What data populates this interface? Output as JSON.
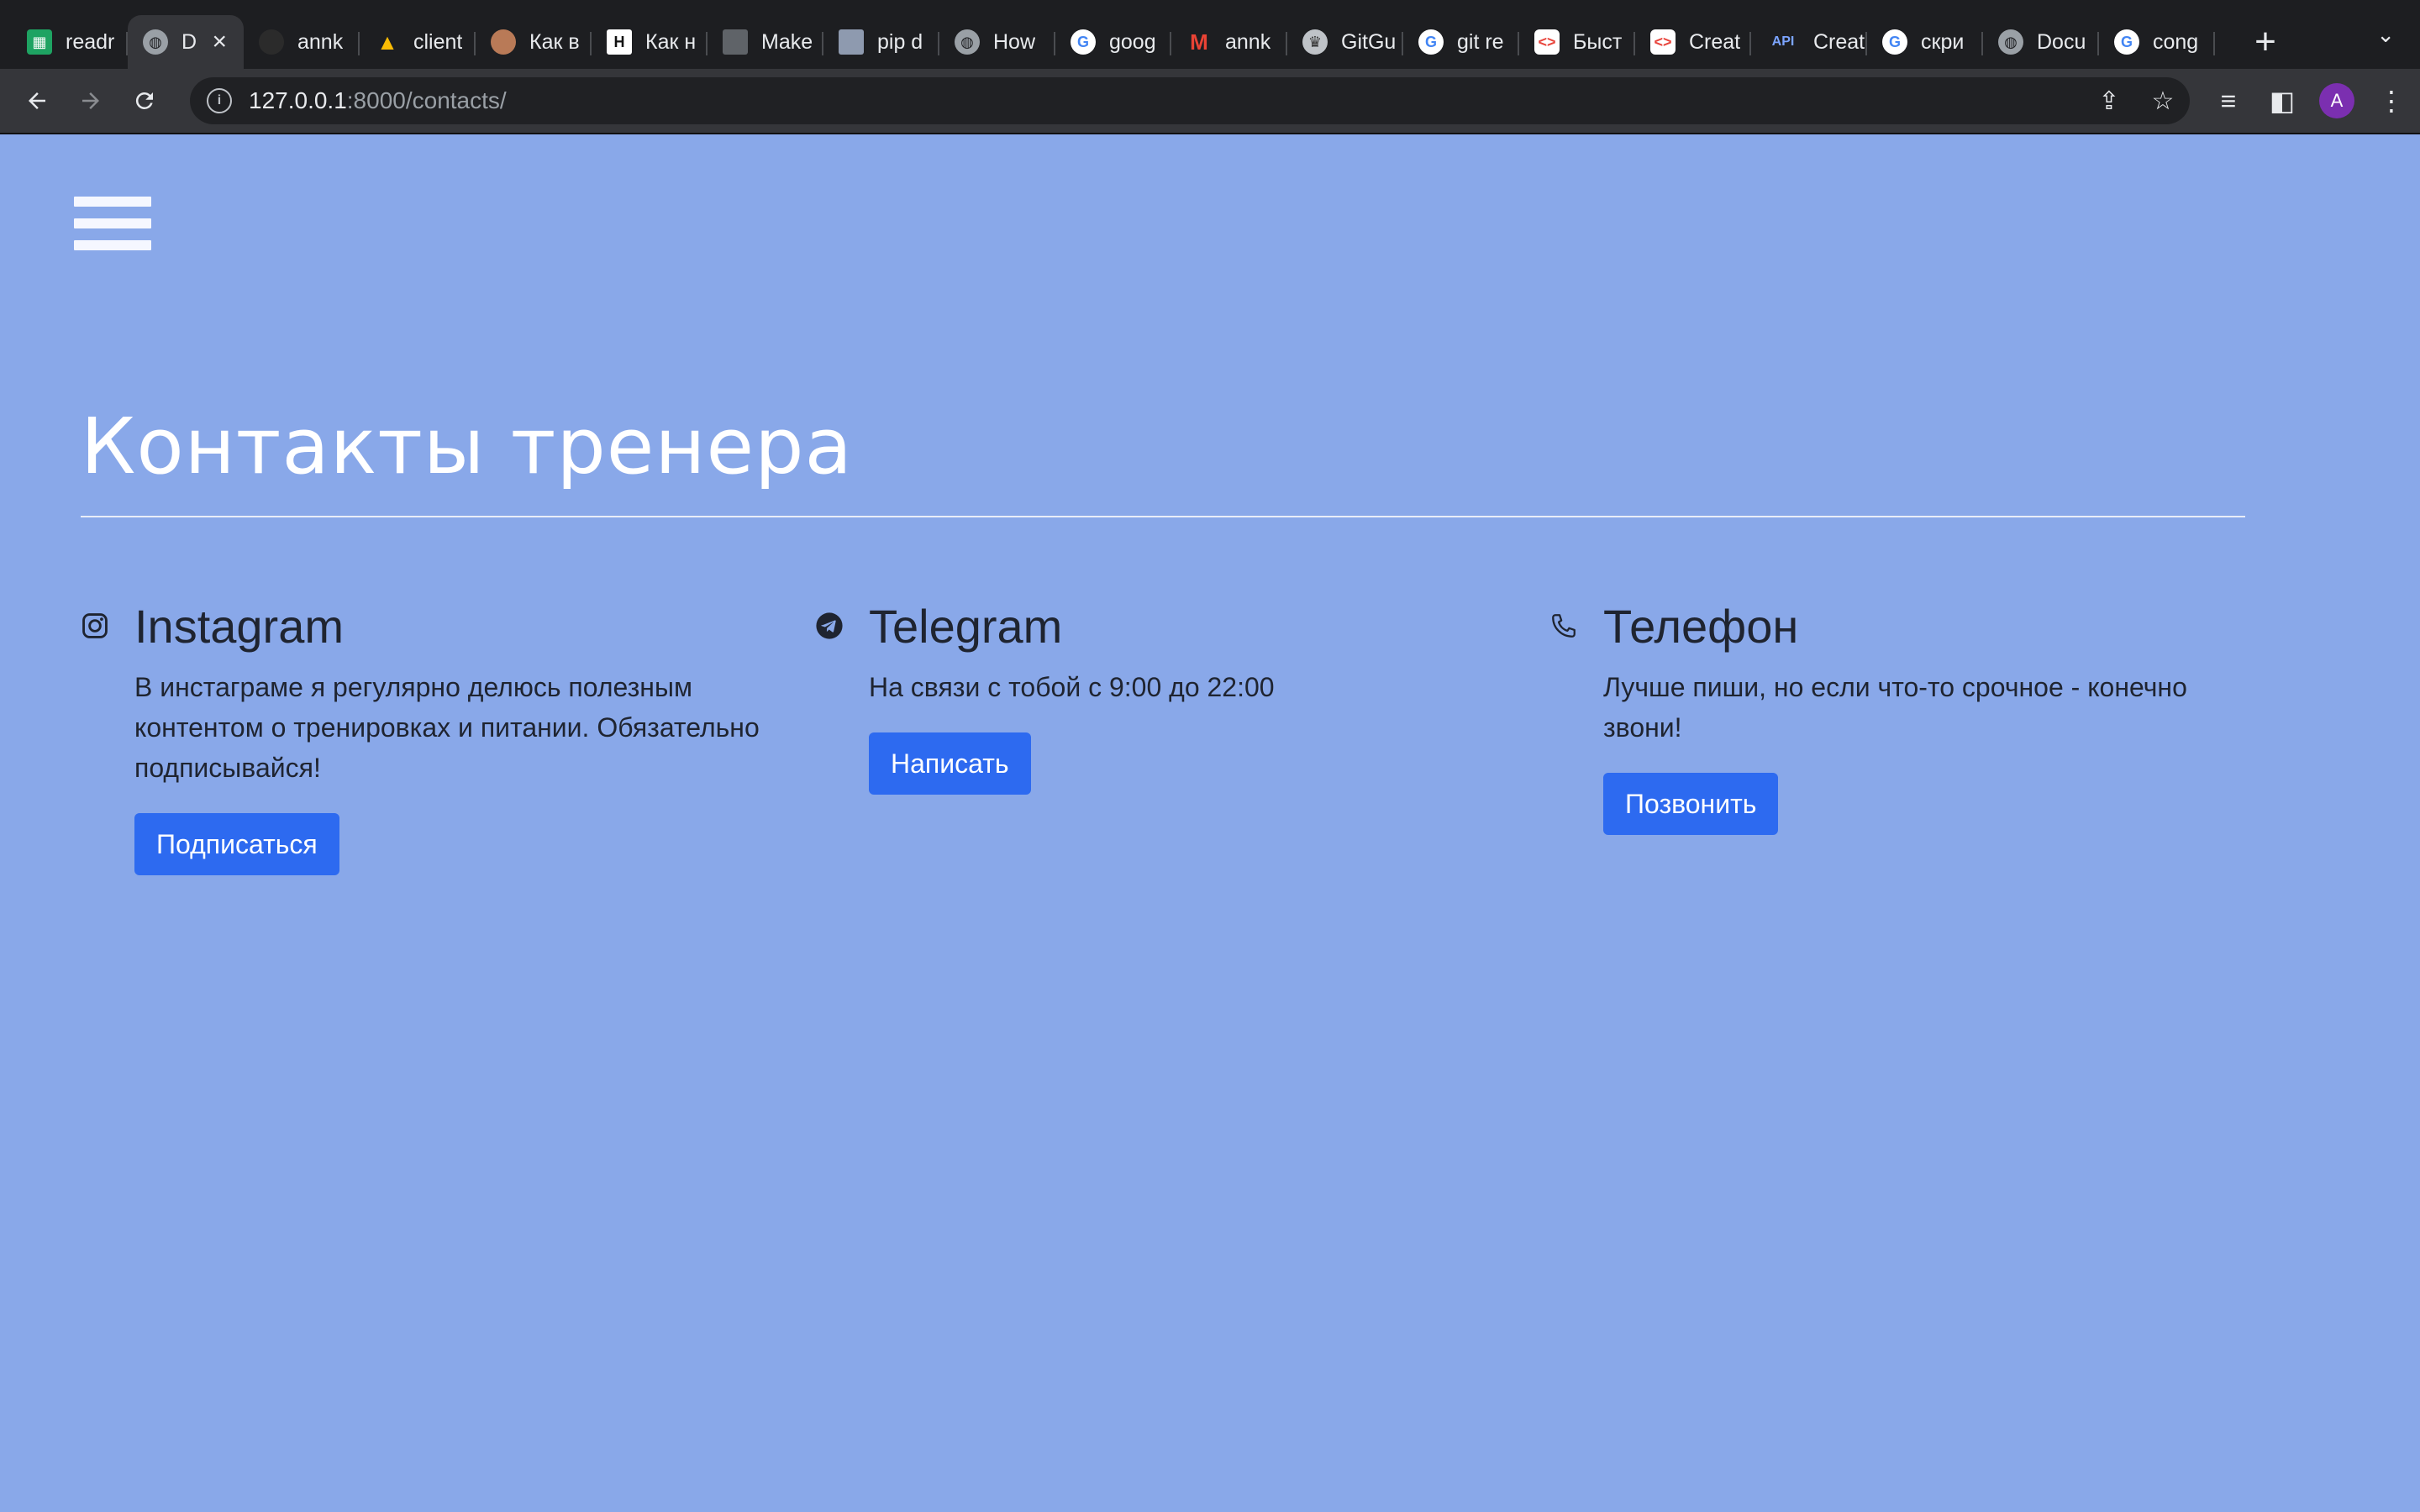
{
  "browser": {
    "tabs": [
      {
        "label": "readr",
        "icon": "sheets-icon"
      },
      {
        "label": "D",
        "icon": "globe-icon",
        "active": true
      },
      {
        "label": "annk",
        "icon": "github-icon"
      },
      {
        "label": "client",
        "icon": "drive-icon"
      },
      {
        "label": "Как в",
        "icon": "avatar-icon"
      },
      {
        "label": "Как н",
        "icon": "h-icon"
      },
      {
        "label": "Make",
        "icon": "doc-icon"
      },
      {
        "label": "pip d",
        "icon": "book-icon"
      },
      {
        "label": "How",
        "icon": "globe-icon"
      },
      {
        "label": "goog",
        "icon": "google-icon"
      },
      {
        "label": "annk",
        "icon": "gmail-icon"
      },
      {
        "label": "GitGu",
        "icon": "gitguardian-icon"
      },
      {
        "label": "git re",
        "icon": "google-icon"
      },
      {
        "label": "Быст",
        "icon": "code-icon"
      },
      {
        "label": "Creat",
        "icon": "code-icon"
      },
      {
        "label": "Creat",
        "icon": "api-icon"
      },
      {
        "label": "скри",
        "icon": "google-icon"
      },
      {
        "label": "Docu",
        "icon": "globe-icon"
      },
      {
        "label": "cong",
        "icon": "google-icon"
      }
    ],
    "url_host": "127.0.0.1",
    "url_path": ":8000/contacts/",
    "avatar_letter": "A"
  },
  "page": {
    "title": "Контакты тренера",
    "contacts": [
      {
        "name": "Instagram",
        "icon": "instagram-icon",
        "description": "В инстаграме я регулярно делюсь полезным контентом о тренировках и питании. Обязательно подписывайся!",
        "button": "Подписаться"
      },
      {
        "name": "Telegram",
        "icon": "telegram-icon",
        "description": "На связи с тобой с 9:00 до 22:00",
        "button": "Написать"
      },
      {
        "name": "Телефон",
        "icon": "phone-icon",
        "description": "Лучше пиши, но если что-то срочное - конечно звони!",
        "button": "Позвонить"
      }
    ]
  },
  "colors": {
    "page_background": "#89a8e9",
    "button": "#2d6af0",
    "title": "#ffffff"
  }
}
